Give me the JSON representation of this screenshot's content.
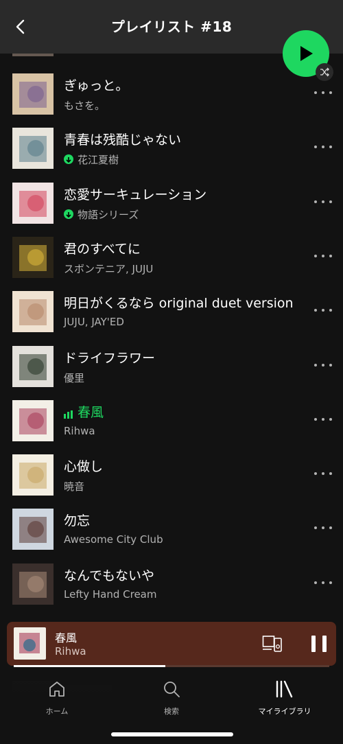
{
  "header": {
    "title": "プレイリスト #18"
  },
  "tracks": [
    {
      "title": "ぎゅっと。",
      "artist": "もさを。",
      "downloaded": false,
      "playing": false,
      "art": [
        "#d8c3a5",
        "#7a5f8f"
      ]
    },
    {
      "title": "青春は残酷じゃない",
      "artist": "花江夏樹",
      "downloaded": true,
      "playing": false,
      "art": [
        "#e9e5dc",
        "#5a7d8a"
      ]
    },
    {
      "title": "恋愛サーキュレーション",
      "artist": "物語シリーズ",
      "downloaded": true,
      "playing": false,
      "art": [
        "#f1e4e4",
        "#d2435b"
      ]
    },
    {
      "title": "君のすべてに",
      "artist": "スボンテニア, JUJU",
      "downloaded": false,
      "playing": false,
      "art": [
        "#2a2418",
        "#d8b43a"
      ]
    },
    {
      "title": "明日がくるなら original duet version",
      "artist": "JUJU, JAY'ED",
      "downloaded": false,
      "playing": false,
      "art": [
        "#f0e3d2",
        "#b7896a"
      ]
    },
    {
      "title": "ドライフラワー",
      "artist": "優里",
      "downloaded": false,
      "playing": false,
      "art": [
        "#e4e1dc",
        "#2b3a2c"
      ]
    },
    {
      "title": "春風",
      "artist": "Rihwa",
      "downloaded": false,
      "playing": true,
      "art": [
        "#f3efe7",
        "#a83e5b"
      ]
    },
    {
      "title": "心做し",
      "artist": "暁音",
      "downloaded": false,
      "playing": false,
      "art": [
        "#f4efe3",
        "#c8a766"
      ]
    },
    {
      "title": "勿忘",
      "artist": "Awesome City Club",
      "downloaded": false,
      "playing": false,
      "art": [
        "#cfd7e0",
        "#5b3a36"
      ]
    },
    {
      "title": "なんでもないや",
      "artist": "Lefty Hand Cream",
      "downloaded": false,
      "playing": false,
      "art": [
        "#3a2f2c",
        "#a88b78"
      ]
    }
  ],
  "now_playing": {
    "title": "春風",
    "artist": "Rihwa",
    "progress": 0.48
  },
  "tabs": [
    {
      "label": "ホーム",
      "icon": "home-icon",
      "active": false
    },
    {
      "label": "検索",
      "icon": "search-icon",
      "active": false
    },
    {
      "label": "マイライブラリ",
      "icon": "library-icon",
      "active": true
    }
  ],
  "colors": {
    "accent": "#1ed760",
    "miniplayer": "#56281c",
    "background": "#121212"
  }
}
